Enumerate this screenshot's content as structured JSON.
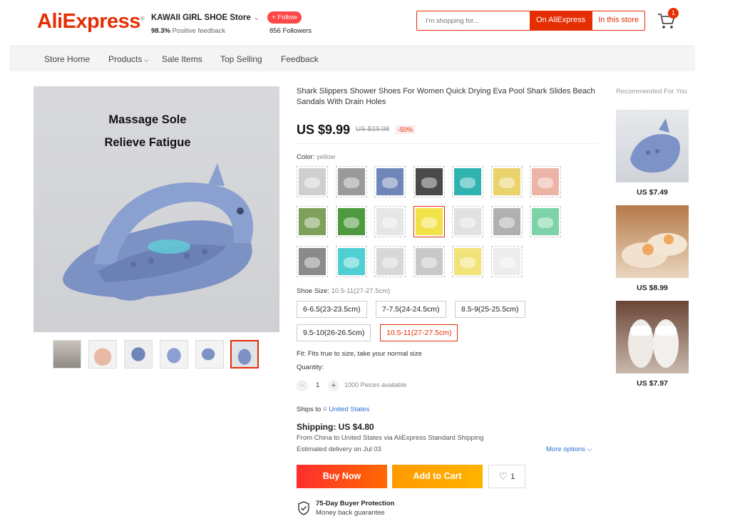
{
  "header": {
    "logo": "AliExpress",
    "store_name": "KAWAII GIRL SHOE Store",
    "feedback_pct": "98.3%",
    "feedback_label": "Positive feedback",
    "follow_label": "+ Follow",
    "followers": "856 Followers",
    "search_placeholder": "I'm shopping for...",
    "search_on_label": "On AliExpress",
    "search_in_label": "In this store",
    "cart_count": "1"
  },
  "nav": {
    "items": [
      "Store Home",
      "Products",
      "Sale Items",
      "Top Selling",
      "Feedback"
    ]
  },
  "gallery": {
    "overlay_line1": "Massage Sole",
    "overlay_line2": "Relieve Fatigue"
  },
  "product": {
    "title": "Shark Slippers Shower Shoes For Women Quick Drying Eva Pool Shark Slides Beach Sandals With Drain Holes",
    "price": "US $9.99",
    "old_price": "US $19.98",
    "discount": "-50%",
    "color_label": "Color:",
    "color_value": "yellow",
    "color_swatches": [
      "#cfcfcf",
      "#9a9a9a",
      "#6f86b8",
      "#4a4a4a",
      "#2fb3b0",
      "#e9d36a",
      "#ecb4a6",
      "#7fa05a",
      "#4e9a3e",
      "#e6e6e6",
      "#f2e24a",
      "#e1e1e1",
      "#b0b0b0",
      "#7dd3a7",
      "#8a8a8a",
      "#4fcfd2",
      "#d8d8d8",
      "#c8c8c8",
      "#f1e27a",
      "#ededed"
    ],
    "size_label": "Shoe Size:",
    "size_value": "10.5-11(27-27.5cm)",
    "sizes": [
      "6-6.5(23-23.5cm)",
      "7-7.5(24-24.5cm)",
      "8.5-9(25-25.5cm)",
      "9.5-10(26-26.5cm)",
      "10.5-11(27-27.5cm)"
    ],
    "fit": "Fit: Fits true to size, take your normal size",
    "quantity_label": "Quantity:",
    "quantity": "1",
    "available": "1000 Pieces available",
    "ships_to_label": "Ships to",
    "ships_to": "United States",
    "shipping": "Shipping: US $4.80",
    "shipping_route": "From China to United States via AliExpress Standard Shipping",
    "delivery": "Estimated delivery on Jul 03",
    "more_options": "More options",
    "buy_now": "Buy Now",
    "add_to_cart": "Add to Cart",
    "wish_count": "1",
    "protection_title": "75-Day Buyer Protection",
    "protection_sub": "Money back guarantee"
  },
  "recommended": {
    "title": "Recommended For You",
    "items": [
      {
        "price": "US $7.49"
      },
      {
        "price": "US $8.99"
      },
      {
        "price": "US $7.97"
      }
    ]
  },
  "colors": {
    "accent": "#e62e04",
    "buy_now": "#ff4747",
    "add_to_cart": "#ffa000",
    "link": "#2e6ed6"
  }
}
